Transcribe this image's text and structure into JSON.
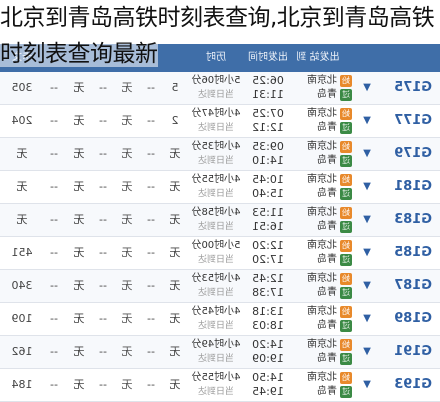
{
  "overlay_title": "北京到青岛高铁时刻表查询,北京到青岛高铁时刻表查询最新",
  "header": {
    "station_header": "出发站 到达站",
    "time_header": "出发时间 到达时间",
    "duration_header": "历时",
    "seat_header": "卡文"
  },
  "rows": [
    {
      "train": "G175",
      "from": "北京南",
      "to": "青岛",
      "dep": "06:25",
      "arr": "11:31",
      "dur": "5小时06分",
      "day": "当日到达",
      "seat_a": "5",
      "seat_b": "--",
      "seat_c": "无",
      "seat_d": "--",
      "seat_e": "无",
      "seat_f": "--",
      "price": "305"
    },
    {
      "train": "G177",
      "from": "北京南",
      "to": "青岛",
      "dep": "07:25",
      "arr": "12:12",
      "dur": "4小时47分",
      "day": "当日到达",
      "seat_a": "2",
      "seat_b": "--",
      "seat_c": "无",
      "seat_d": "--",
      "seat_e": "无",
      "seat_f": "--",
      "price": "204"
    },
    {
      "train": "G179",
      "from": "北京南",
      "to": "青岛",
      "dep": "09:35",
      "arr": "14:10",
      "dur": "4小时35分",
      "day": "当日到达",
      "seat_a": "无",
      "seat_b": "--",
      "seat_c": "无",
      "seat_d": "--",
      "seat_e": "无",
      "seat_f": "--",
      "price": "无"
    },
    {
      "train": "G181",
      "from": "北京南",
      "to": "青岛",
      "dep": "10:45",
      "arr": "15:40",
      "dur": "4小时55分",
      "day": "当日到达",
      "seat_a": "无",
      "seat_b": "--",
      "seat_c": "无",
      "seat_d": "--",
      "seat_e": "无",
      "seat_f": "--",
      "price": "无"
    },
    {
      "train": "G183",
      "from": "北京南",
      "to": "青岛",
      "dep": "11:53",
      "arr": "16:51",
      "dur": "4小时58分",
      "day": "当日到达",
      "seat_a": "无",
      "seat_b": "--",
      "seat_c": "无",
      "seat_d": "--",
      "seat_e": "无",
      "seat_f": "--",
      "price": "无"
    },
    {
      "train": "G185",
      "from": "北京南",
      "to": "青岛",
      "dep": "12:20",
      "arr": "17:20",
      "dur": "5小时00分",
      "day": "当日到达",
      "seat_a": "无",
      "seat_b": "--",
      "seat_c": "无",
      "seat_d": "--",
      "seat_e": "无",
      "seat_f": "--",
      "price": "451"
    },
    {
      "train": "G187",
      "from": "北京南",
      "to": "青岛",
      "dep": "12:45",
      "arr": "17:38",
      "dur": "4小时53分",
      "day": "当日到达",
      "seat_a": "无",
      "seat_b": "--",
      "seat_c": "无",
      "seat_d": "--",
      "seat_e": "无",
      "seat_f": "--",
      "price": "340"
    },
    {
      "train": "G189",
      "from": "北京南",
      "to": "青岛",
      "dep": "13:18",
      "arr": "18:03",
      "dur": "4小时45分",
      "day": "当日到达",
      "seat_a": "无",
      "seat_b": "--",
      "seat_c": "无",
      "seat_d": "--",
      "seat_e": "无",
      "seat_f": "--",
      "price": "109"
    },
    {
      "train": "G191",
      "from": "北京南",
      "to": "青岛",
      "dep": "14:20",
      "arr": "19:09",
      "dur": "4小时49分",
      "day": "当日到达",
      "seat_a": "无",
      "seat_b": "--",
      "seat_c": "无",
      "seat_d": "--",
      "seat_e": "无",
      "seat_f": "--",
      "price": "162"
    },
    {
      "train": "G193",
      "from": "北京南",
      "to": "青岛",
      "dep": "14:50",
      "arr": "19:45",
      "dur": "4小时55分",
      "day": "当日到达",
      "seat_a": "无",
      "seat_b": "--",
      "seat_c": "无",
      "seat_d": "--",
      "seat_e": "无",
      "seat_f": "--",
      "price": "184"
    }
  ],
  "icons": {
    "expand": "chevron-down-icon",
    "start": "始",
    "pass": "过"
  },
  "colors": {
    "train_link": "#2f5fa3",
    "header_bg": "#3f6ea8",
    "start_badge": "#e8892b",
    "pass_badge": "#3b8a45"
  }
}
